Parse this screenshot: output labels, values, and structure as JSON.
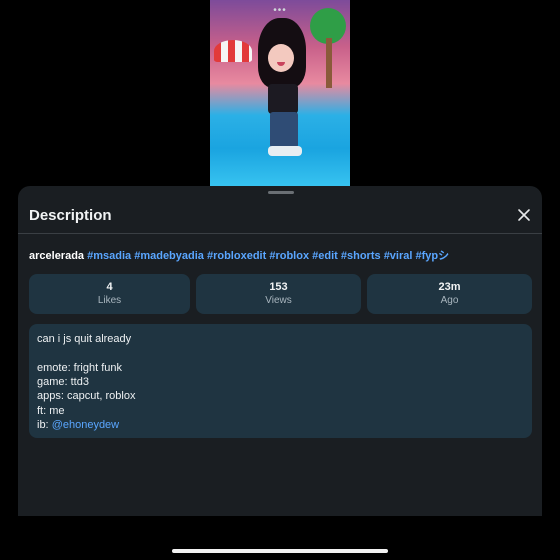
{
  "video": {
    "menu_dots": "•••"
  },
  "sheet": {
    "title": "Description",
    "close_icon": "close-icon"
  },
  "caption": {
    "username": "arcelerada",
    "hashtags": [
      "#msadia",
      "#madebyadia",
      "#robloxedit",
      "#roblox",
      "#edit",
      "#shorts",
      "#viral",
      "#fypシ"
    ]
  },
  "stats": [
    {
      "value": "4",
      "label": "Likes"
    },
    {
      "value": "153",
      "label": "Views"
    },
    {
      "value": "23m",
      "label": "Ago"
    }
  ],
  "description": {
    "line1": "can i js quit already",
    "line2": "emote: fright funk",
    "line3": "game: ttd3",
    "line4": "apps: capcut, roblox",
    "line5": "ft: me",
    "line6_prefix": "ib: ",
    "line6_link": "@ehoneydew"
  },
  "colors": {
    "sheet_bg": "#1a1e22",
    "card_bg": "#1f3441",
    "link": "#5aa6ff"
  }
}
